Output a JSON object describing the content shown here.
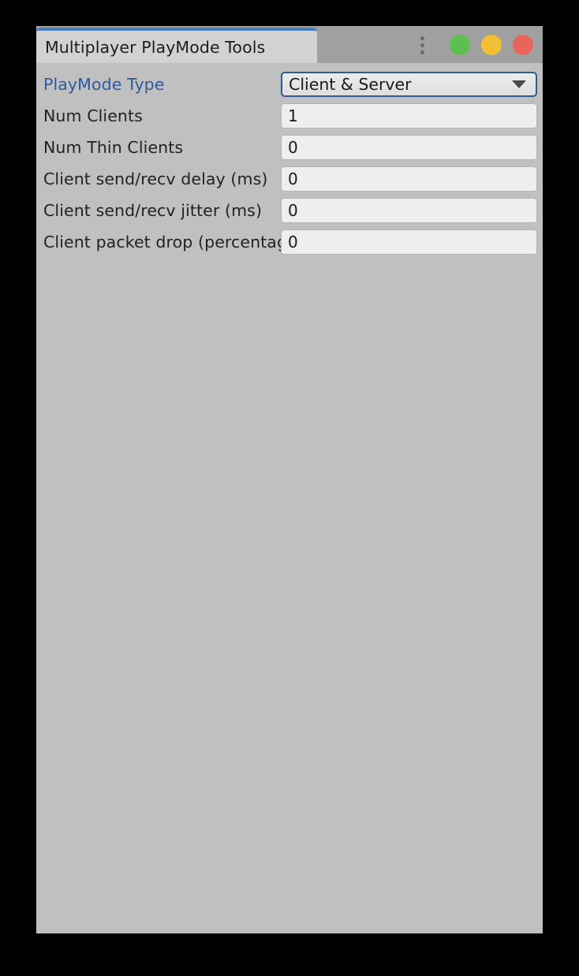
{
  "window": {
    "tab_title": "Multiplayer PlayMode Tools"
  },
  "titlebar": {
    "menu_icon": "kebab-menu-icon",
    "buttons": [
      {
        "name": "minimize",
        "color": "#5cbf4f"
      },
      {
        "name": "maximize",
        "color": "#f0c032"
      },
      {
        "name": "close",
        "color": "#e8655e"
      }
    ]
  },
  "rows": [
    {
      "label": "PlayMode Type",
      "accent": true,
      "control": "dropdown",
      "value": "Client & Server",
      "arrow_icon": "chevron-down-icon"
    },
    {
      "label": "Num Clients",
      "accent": false,
      "control": "text",
      "value": "1"
    },
    {
      "label": "Num Thin Clients",
      "accent": false,
      "control": "text",
      "value": "0"
    },
    {
      "label": "Client send/recv delay (ms)",
      "accent": false,
      "control": "text",
      "value": "0"
    },
    {
      "label": "Client send/recv jitter (ms)",
      "accent": false,
      "control": "text",
      "value": "0"
    },
    {
      "label": "Client packet drop (percentage)",
      "accent": false,
      "control": "text",
      "value": "0"
    }
  ]
}
